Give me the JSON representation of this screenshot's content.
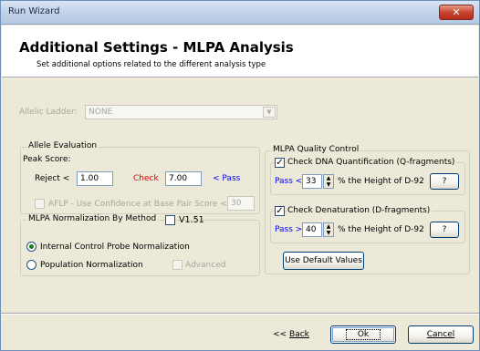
{
  "window": {
    "title": "Run Wizard",
    "close_glyph": "✕"
  },
  "header": {
    "title": "Additional Settings - MLPA Analysis",
    "subtitle": "Set additional options related to the different analysis type"
  },
  "allelic_ladder": {
    "label": "Allelic Ladder:",
    "value": "NONE"
  },
  "allele_evaluation": {
    "title": "Allele Evaluation",
    "peak_score_label": "Peak Score:",
    "reject_label": "Reject <",
    "reject_value": "1.00",
    "check_label": "Check",
    "check_value": "7.00",
    "pass_label": "< Pass",
    "aflp_label": "AFLP - Use Confidence at Base Pair   Score <",
    "aflp_value": "30"
  },
  "mlpa_normalization": {
    "title": "MLPA Normalization By Method",
    "v151_label": "V1.51",
    "option_internal": "Internal Control Probe Normalization",
    "option_population": "Population Normalization",
    "advanced_label": "Advanced"
  },
  "mlpa_quality": {
    "title": "MLPA Quality Control",
    "dna_check_label": "Check DNA Quantification (Q-fragments)",
    "dna_pass_label": "Pass <",
    "dna_value": "33",
    "dna_suffix": "% the Height of D-92",
    "help_label": "?",
    "den_check_label": "Check Denaturation (D-fragments)",
    "den_pass_label": "Pass >",
    "den_value": "40",
    "den_suffix": "% the Height of D-92",
    "default_button": "Use Default Values"
  },
  "footer": {
    "back": "Back",
    "ok": "Ok",
    "cancel": "Cancel"
  },
  "colors": {
    "pass": "#0000ff",
    "check": "#e00000"
  }
}
